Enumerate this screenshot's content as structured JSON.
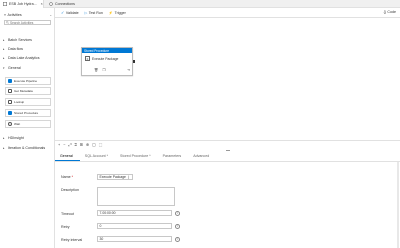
{
  "tabs": [
    {
      "label": "ESB Job Hydra..."
    },
    {
      "label": "Connections"
    }
  ],
  "sidebar": {
    "title": "Activities",
    "search_placeholder": "Search Activities",
    "categories": [
      {
        "label": "Batch Services"
      },
      {
        "label": "Data flow"
      },
      {
        "label": "Data Lake Analytics"
      },
      {
        "label": "General"
      },
      {
        "label": "HDInsight"
      },
      {
        "label": "Iteration & Conditionals"
      }
    ],
    "general_items": [
      {
        "label": "Execute Pipeline"
      },
      {
        "label": "Get Metadata"
      },
      {
        "label": "Lookup"
      },
      {
        "label": "Stored Procedure"
      },
      {
        "label": "Wait"
      }
    ]
  },
  "toolbar": {
    "validate": "Validate",
    "test_run": "Test Run",
    "trigger": "Trigger",
    "code": "Code"
  },
  "node": {
    "header": "Stored Procedure",
    "title": "Execute Package"
  },
  "properties": {
    "tabs": [
      "General",
      "SQL Account *",
      "Stored Procedure *",
      "Parameters",
      "Advanced"
    ],
    "active_tab": "General",
    "fields": {
      "name_label": "Name",
      "name_value": "Execute Package",
      "description_label": "Description",
      "timeout_label": "Timeout",
      "timeout_value": "7.00:00:00",
      "retry_label": "Retry",
      "retry_value": "0",
      "retry_interval_label": "Retry interval",
      "retry_interval_value": "30"
    }
  },
  "colors": {
    "accent": "#0078d4"
  }
}
